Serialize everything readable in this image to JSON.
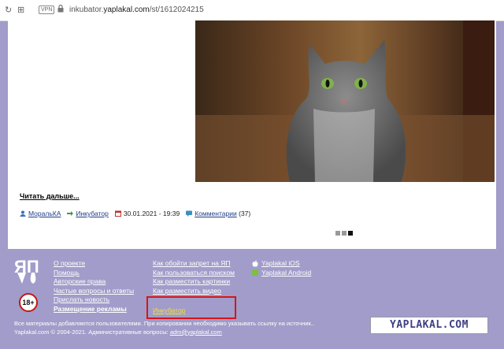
{
  "browser": {
    "url_prefix": "inkubator.",
    "url_domain": "yaplakal.com",
    "url_path": "/st/1612024215",
    "vpn_label": "VPN"
  },
  "post": {
    "read_more": "Читать дальше...",
    "author": "МоральКА",
    "section": "Инкубатор",
    "date": "30.01.2021 - 19:39",
    "comments_label": "Комментарии",
    "comments_count": "(37)"
  },
  "footer": {
    "col1": [
      "О проекте",
      "Помощь",
      "Авторские права",
      "Частые вопросы и ответы",
      "Прислать новость",
      "Размещение рекламы"
    ],
    "col2": [
      "Как обойти запрет на ЯП",
      "Как пользоваться поиском",
      "Как разместить картинки",
      "Как разместить видео"
    ],
    "incubator": "Инкубатор",
    "apps": [
      "Yaplakal iOS",
      "Yaplakal Android"
    ],
    "age_badge": "18+",
    "logo_text": "ЯП",
    "disclaimer": "Все материалы добавляются пользователями. При копировании необходимо указывать ссылку на источник..",
    "copyright": "Yaplakal.com © 2004-2021. Административные вопросы:",
    "email": "adm@yaplakal.com",
    "watermark": "YAPLAKAL.COM"
  },
  "colors": {
    "page_bg": "#a19cc9",
    "highlight": "#d8141a",
    "incubator_link": "#f0e040"
  }
}
